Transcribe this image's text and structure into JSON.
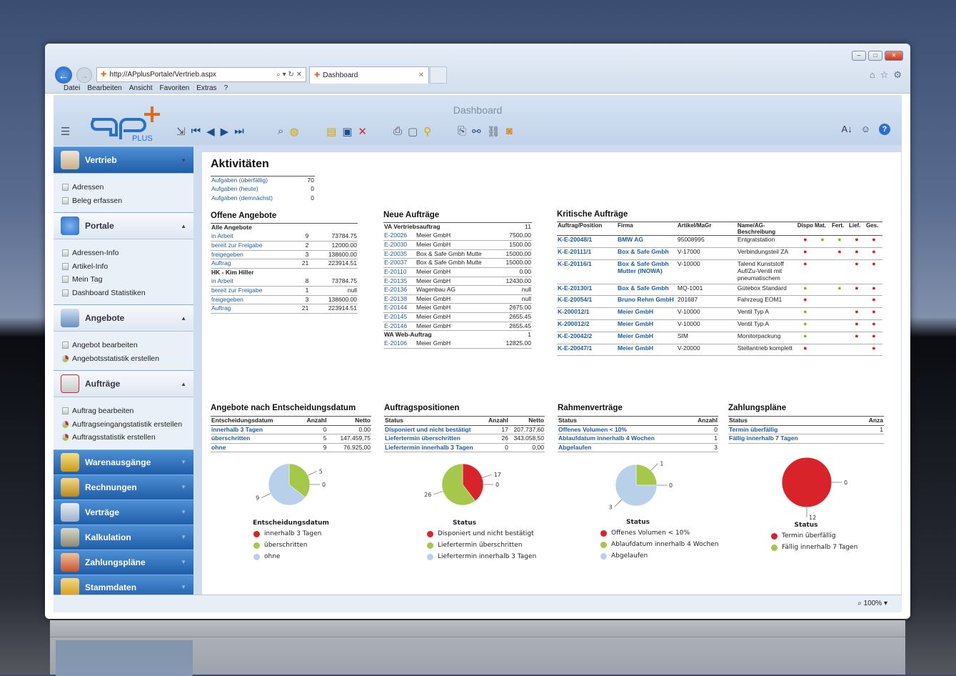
{
  "browser": {
    "url": "http://APplusPortale/Vertrieb.aspx",
    "tab_title": "Dashboard",
    "menu": [
      "Datei",
      "Bearbeiten",
      "Ansicht",
      "Favoriten",
      "Extras",
      "?"
    ]
  },
  "app": {
    "title": "Dashboard",
    "logo": "PLUS",
    "zoom": "100%"
  },
  "sidebar": {
    "vertrieb": {
      "label": "Vertrieb",
      "items": [
        "Adressen",
        "Beleg erfassen"
      ]
    },
    "portale": {
      "label": "Portale",
      "items": [
        "Adressen-Info",
        "Artikel-Info",
        "Mein Tag",
        "Dashboard Statistiken"
      ]
    },
    "angebote": {
      "label": "Angebote",
      "items": [
        "Angebot bearbeiten",
        "Angebotsstatistik erstellen"
      ]
    },
    "auftraege": {
      "label": "Aufträge",
      "items": [
        "Auftrag bearbeiten",
        "Auftragseingangstatistik erstellen",
        "Auftragsstatistik erstellen"
      ]
    },
    "closed": [
      "Warenausgänge",
      "Rechnungen",
      "Verträge",
      "Kalkulation",
      "Zahlungspläne",
      "Stammdaten"
    ]
  },
  "aktivitaeten": {
    "title": "Aktivitäten",
    "rows": [
      [
        "Aufgaben (überfällig)",
        "70"
      ],
      [
        "Aufgaben (heute)",
        "0"
      ],
      [
        "Aufgaben (demnächst)",
        "0"
      ]
    ]
  },
  "offene_angebote": {
    "title": "Offene Angebote",
    "group1": "Alle Angebote",
    "rows1": [
      [
        "in Arbeit",
        "9",
        "73784.75"
      ],
      [
        "bereit zur Freigabe",
        "2",
        "12000.00"
      ],
      [
        "freigegeben",
        "3",
        "138600.00"
      ],
      [
        "Auftrag",
        "21",
        "223914.51"
      ]
    ],
    "group2": "HK - Kim Hiller",
    "rows2": [
      [
        "in Arbeit",
        "8",
        "73784.75"
      ],
      [
        "bereit zur Freigabe",
        "1",
        "null"
      ],
      [
        "freigegeben",
        "3",
        "138600.00"
      ],
      [
        "Auftrag",
        "21",
        "223914.51"
      ]
    ]
  },
  "neue_auftraege": {
    "title": "Neue Aufträge",
    "group1": "VA Vertriebsauftrag",
    "count1": "11",
    "rows1": [
      [
        "E-20026",
        "Meier GmbH",
        "7500.00"
      ],
      [
        "E-20030",
        "Meier GmbH",
        "1500.00"
      ],
      [
        "E-20035",
        "Box & Safe Gmbh Mutte",
        "15000.00"
      ],
      [
        "E-20037",
        "Box & Safe Gmbh Mutte",
        "15000.00"
      ],
      [
        "E-20110",
        "Meier GmbH",
        "0.00"
      ],
      [
        "E-20135",
        "Meier GmbH",
        "12430.00"
      ],
      [
        "E-20136",
        "Wagenbau AG",
        "null"
      ],
      [
        "E-20138",
        "Meier GmbH",
        "null"
      ],
      [
        "E-20144",
        "Meier GmbH",
        "2675.00"
      ],
      [
        "E-20145",
        "Meier GmbH",
        "2655.45"
      ],
      [
        "E-20146",
        "Meier GmbH",
        "2655.45"
      ]
    ],
    "group2": "WA Web-Auftrag",
    "count2": "1",
    "rows2": [
      [
        "E-20106",
        "Meier GmbH",
        "12825.00"
      ]
    ]
  },
  "kritische": {
    "title": "Kritische Aufträge",
    "headers": [
      "Auftrag/Position",
      "Firma",
      "Artikel/MaGr",
      "Name/AG-Beschreibung",
      "Dispo",
      "Mat.",
      "Fert.",
      "Lief.",
      "Ges."
    ],
    "rows": [
      {
        "id": "K-E-20048/1",
        "firma": "BMW AG",
        "artikel": "95008995",
        "name": "Entgratstation",
        "d": [
          "r",
          "g",
          "g",
          "r",
          "r"
        ]
      },
      {
        "id": "K-E-20111/1",
        "firma": "Box & Safe Gmbh",
        "artikel": "V-17000",
        "name": "Verbindungsteil ZA",
        "d": [
          "r",
          "",
          "r",
          "r",
          "r"
        ]
      },
      {
        "id": "K-E-20116/1",
        "firma": "Box & Safe Gmbh Mutter (INOWA)",
        "artikel": "V-10000",
        "name": "Talend Kunststoff Auf/Zu-Ventil mit pneumatischem",
        "d": [
          "r",
          "",
          "",
          "r",
          "r"
        ]
      },
      {
        "id": "K-E-20130/1",
        "firma": "Box & Safe Gmbh",
        "artikel": "MQ-1001",
        "name": "Gütebox Standard",
        "d": [
          "g",
          "",
          "g",
          "r",
          "r"
        ]
      },
      {
        "id": "K-E-20054/1",
        "firma": "Bruno Rehm GmbH",
        "artikel": "201687",
        "name": "Fahrzeug EOM1",
        "d": [
          "r",
          "",
          "",
          "",
          "r"
        ]
      },
      {
        "id": "K-200012/1",
        "firma": "Meier GmbH",
        "artikel": "V-10000",
        "name": "Ventil Typ A",
        "d": [
          "g",
          "",
          "",
          "r",
          "r"
        ]
      },
      {
        "id": "K-200012/2",
        "firma": "Meier GmbH",
        "artikel": "V-10000",
        "name": "Ventil Typ A",
        "d": [
          "g",
          "",
          "",
          "r",
          "r"
        ]
      },
      {
        "id": "K-E-20042/2",
        "firma": "Meier GmbH",
        "artikel": "SIM",
        "name": "Monitorpackung",
        "d": [
          "g",
          "",
          "",
          "r",
          "r"
        ]
      },
      {
        "id": "K-E-20047/1",
        "firma": "Meier GmbH",
        "artikel": "V-20000",
        "name": "Stellantrieb komplett",
        "d": [
          "r",
          "",
          "",
          "",
          "r"
        ]
      }
    ]
  },
  "panels": [
    {
      "title": "Angebote nach Entscheidungsdatum",
      "headers": [
        "Entscheidungsdatum",
        "Anzahl",
        "Netto"
      ],
      "rows": [
        [
          "innerhalb 3 Tagen",
          "0",
          "0.00"
        ],
        [
          "überschritten",
          "5",
          "147.459,75"
        ],
        [
          "ohne",
          "9",
          "76.925,00"
        ]
      ],
      "chart_title": "Entscheidungsdatum",
      "legend": [
        "innerhalb 3 Tagen",
        "überschritten",
        "ohne"
      ]
    },
    {
      "title": "Auftragspositionen",
      "headers": [
        "Status",
        "Anzahl",
        "Netto"
      ],
      "rows": [
        [
          "Disponiert und nicht bestätigt",
          "17",
          "207.737,60"
        ],
        [
          "Liefertermin überschritten",
          "26",
          "343.058,50"
        ],
        [
          "Liefertermin innerhalb 3 Tagen",
          "0",
          "0,00"
        ]
      ],
      "chart_title": "Status",
      "legend": [
        "Disponiert und nicht bestätigt",
        "Liefertermin überschritten",
        "Liefertermin innerhalb 3 Tagen"
      ]
    },
    {
      "title": "Rahmenverträge",
      "headers": [
        "Status",
        "Anzahl"
      ],
      "rows": [
        [
          "Offenes Volumen < 10%",
          "0"
        ],
        [
          "Ablaufdatum innerhalb 4 Wochen",
          "1"
        ],
        [
          "Abgelaufen",
          "3"
        ]
      ],
      "chart_title": "Status",
      "legend": [
        "Offenes Volumen < 10%",
        "Ablaufdatum innerhalb 4 Wochen",
        "Abgelaufen"
      ]
    },
    {
      "title": "Zahlungspläne",
      "headers": [
        "Status",
        "Anza"
      ],
      "rows": [
        [
          "Termin überfällig",
          "1"
        ],
        [
          "Fällig innerhalb 7 Tagen",
          ""
        ]
      ],
      "chart_title": "Status",
      "legend": [
        "Termin überfällig",
        "Fällig innerhalb 7 Tagen"
      ]
    }
  ],
  "chart_data": [
    {
      "type": "pie",
      "title": "Entscheidungsdatum",
      "categories": [
        "innerhalb 3 Tagen",
        "überschritten",
        "ohne"
      ],
      "values": [
        0,
        5,
        9
      ],
      "colors": [
        "#d8232a",
        "#a6c84a",
        "#b8d0ea"
      ]
    },
    {
      "type": "pie",
      "title": "Status",
      "categories": [
        "Disponiert und nicht bestätigt",
        "Liefertermin überschritten",
        "Liefertermin innerhalb 3 Tagen"
      ],
      "values": [
        17,
        26,
        0
      ],
      "colors": [
        "#d8232a",
        "#a6c84a",
        "#b8d0ea"
      ]
    },
    {
      "type": "pie",
      "title": "Status",
      "categories": [
        "Offenes Volumen < 10%",
        "Ablaufdatum innerhalb 4 Wochen",
        "Abgelaufen"
      ],
      "values": [
        0,
        1,
        3
      ],
      "colors": [
        "#d8232a",
        "#a6c84a",
        "#b8d0ea"
      ]
    },
    {
      "type": "pie",
      "title": "Status",
      "categories": [
        "Termin überfällig",
        "Fällig innerhalb 7 Tagen"
      ],
      "values": [
        12,
        0
      ],
      "colors": [
        "#d8232a",
        "#a6c84a"
      ]
    }
  ],
  "colors": {
    "red": "#d8232a",
    "green": "#a6c84a",
    "blue": "#b8d0ea",
    "link": "#1b5d9e"
  }
}
